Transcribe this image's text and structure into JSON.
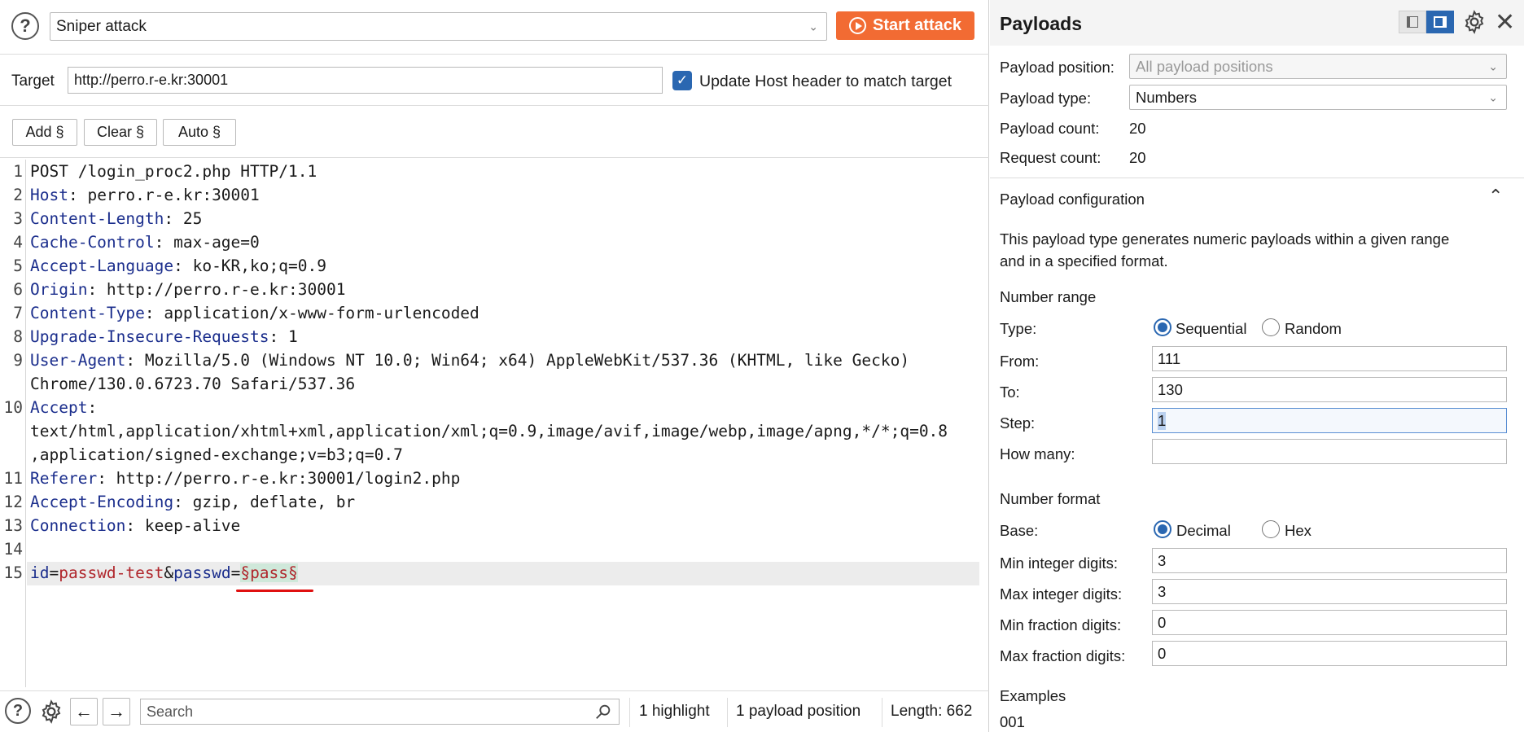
{
  "attack_type": {
    "value": "Sniper attack"
  },
  "start_attack": {
    "label": "Start attack"
  },
  "target": {
    "label": "Target",
    "value": "http://perro.r-e.kr:30001",
    "update_host_label": "Update Host header to match target",
    "update_host_checked": true
  },
  "marker_buttons": {
    "add": "Add §",
    "clear": "Clear §",
    "auto": "Auto §"
  },
  "request": {
    "line_numbers": [
      "1",
      "2",
      "3",
      "4",
      "5",
      "6",
      "7",
      "8",
      "9",
      "10",
      "11",
      "12",
      "13",
      "14",
      "15"
    ],
    "l1": "POST /login_proc2.php HTTP/1.1",
    "h2k": "Host",
    "h2v": ": perro.r-e.kr:30001",
    "h3k": "Content-Length",
    "h3v": ": 25",
    "h4k": "Cache-Control",
    "h4v": ": max-age=0",
    "h5k": "Accept-Language",
    "h5v": ": ko-KR,ko;q=0.9",
    "h6k": "Origin",
    "h6v": ": http://perro.r-e.kr:30001",
    "h7k": "Content-Type",
    "h7v": ": application/x-www-form-urlencoded",
    "h8k": "Upgrade-Insecure-Requests",
    "h8v": ": 1",
    "h9k": "User-Agent",
    "h9v": ": Mozilla/5.0 (Windows NT 10.0; Win64; x64) AppleWebKit/537.36 (KHTML, like Gecko)",
    "h9v2": "Chrome/130.0.6723.70 Safari/537.36",
    "h10k": "Accept",
    "h10v": ":",
    "h10v2": "text/html,application/xhtml+xml,application/xml;q=0.9,image/avif,image/webp,image/apng,*/*;q=0.8",
    "h10v3": ",application/signed-exchange;v=b3;q=0.7",
    "h11k": "Referer",
    "h11v": ": http://perro.r-e.kr:30001/login2.php",
    "h12k": "Accept-Encoding",
    "h12v": ": gzip, deflate, br",
    "h13k": "Connection",
    "h13v": ": keep-alive",
    "b_id_k": "id",
    "b_eq1": "=",
    "b_id_v": "passwd-test",
    "b_amp": "&",
    "b_pw_k": "passwd",
    "b_eq2": "=",
    "b_payload": "§pass§"
  },
  "bottom": {
    "search_placeholder": "Search",
    "highlight": "1 highlight",
    "positions": "1 payload position",
    "length": "Length: 662"
  },
  "payloads": {
    "title": "Payloads",
    "position_label": "Payload position:",
    "position_value": "All payload positions",
    "type_label": "Payload type:",
    "type_value": "Numbers",
    "count_label": "Payload count:",
    "count_value": "20",
    "request_label": "Request count:",
    "request_value": "20",
    "config_title": "Payload configuration",
    "description_1": "This payload type generates numeric payloads within a given range",
    "description_2": "and in a specified format.",
    "range_title": "Number range",
    "range_type_label": "Type:",
    "sequential": "Sequential",
    "random": "Random",
    "from_label": "From:",
    "from_value": "111",
    "to_label": "To:",
    "to_value": "130",
    "step_label": "Step:",
    "step_value": "1",
    "howmany_label": "How many:",
    "howmany_value": "",
    "format_title": "Number format",
    "base_label": "Base:",
    "decimal": "Decimal",
    "hex": "Hex",
    "min_int_label": "Min integer digits:",
    "min_int_value": "3",
    "max_int_label": "Max integer digits:",
    "max_int_value": "3",
    "min_frac_label": "Min fraction digits:",
    "min_frac_value": "0",
    "max_frac_label": "Max fraction digits:",
    "max_frac_value": "0",
    "examples_title": "Examples",
    "example_1": "001"
  },
  "colors": {
    "accent": "#f26b33",
    "primary_blue": "#2a67b1",
    "header_key": "#1a2d8c",
    "param_value": "#b0262c",
    "payload_bg": "#cfe8da"
  },
  "icons": [
    "help-icon",
    "play-icon",
    "checkmark-icon",
    "settings-icon",
    "arrow-left-icon",
    "arrow-right-icon",
    "search-icon",
    "layout-left-icon",
    "layout-right-icon",
    "close-icon",
    "chevron-up-icon",
    "chevron-down-icon"
  ]
}
